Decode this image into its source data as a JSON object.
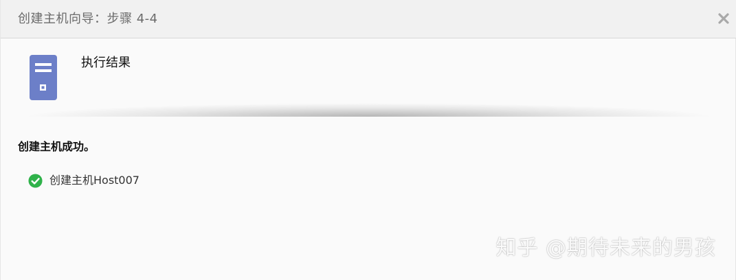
{
  "dialog": {
    "title": "创建主机向导：步骤 4-4",
    "close_icon": "close-x-icon"
  },
  "header": {
    "icon": "server-icon",
    "step_title": "执行结果"
  },
  "result": {
    "heading": "创建主机成功。",
    "items": [
      {
        "status_icon": "success-check-icon",
        "label": "创建主机Host007"
      }
    ]
  },
  "watermark": "知乎 @期待未来的男孩",
  "colors": {
    "titlebar_bg": "#f1f1f1",
    "server_icon": "#6c7fc8",
    "success": "#2fb24a"
  }
}
